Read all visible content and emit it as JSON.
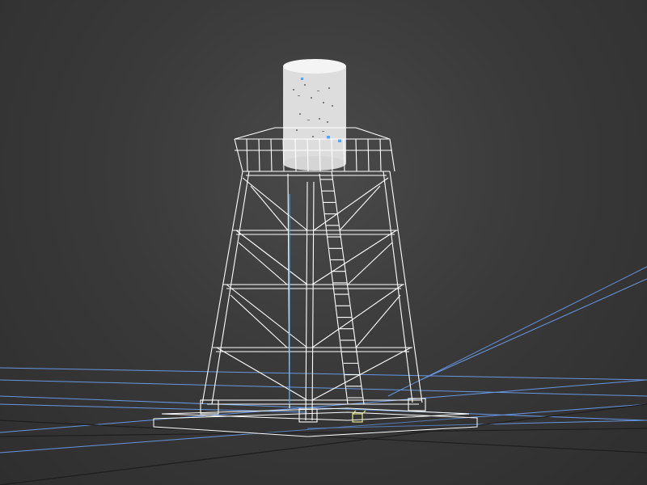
{
  "viewport": {
    "background_color": "#3b3b3b",
    "wire_color": "#ffffff",
    "grid_color": "#6fa8ff",
    "helper_color": "#e6e98a",
    "selection_color": "#4da3ff"
  },
  "scene": {
    "object": "water-tower",
    "display_mode": "wireframe",
    "parts": [
      "water-tank",
      "railing-platform",
      "lattice-legs",
      "cross-bracing",
      "ladder",
      "base-plate"
    ]
  }
}
